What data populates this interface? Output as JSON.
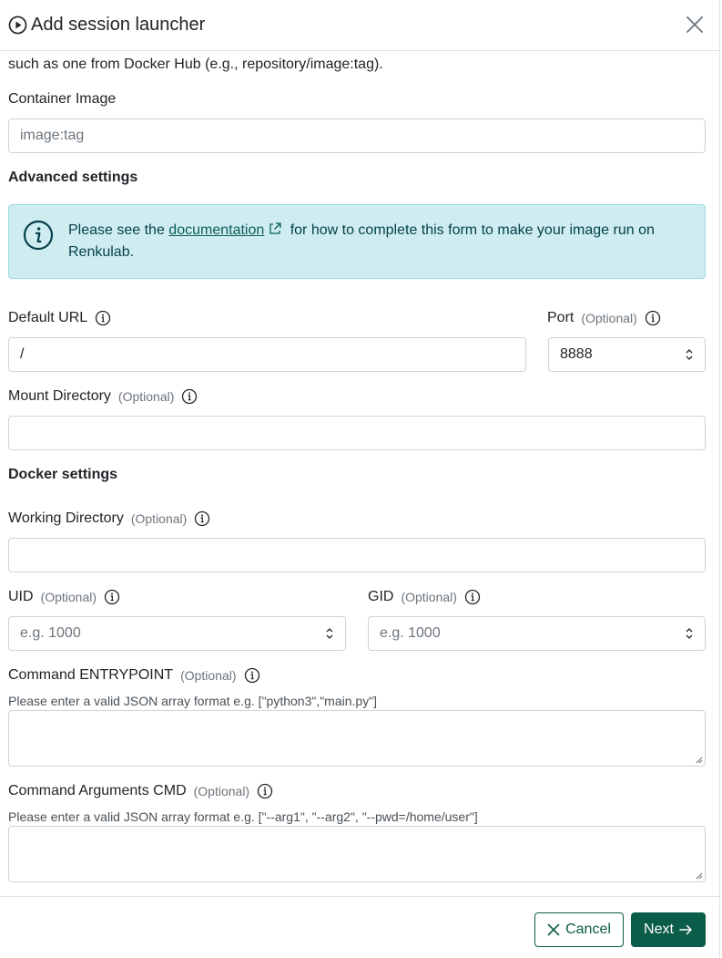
{
  "modal": {
    "title": "Add session launcher",
    "intro_text": "such as one from Docker Hub (e.g., repository/image:tag)."
  },
  "container_image": {
    "label": "Container Image",
    "placeholder": "image:tag"
  },
  "advanced": {
    "title": "Advanced settings",
    "alert_before": "Please see the ",
    "alert_link": "documentation",
    "alert_after": " for how to complete this form to make your image run on Renkulab."
  },
  "default_url": {
    "label": "Default URL",
    "value": "/"
  },
  "port": {
    "label": "Port",
    "optional": "(Optional)",
    "value": "8888"
  },
  "mount_directory": {
    "label": "Mount Directory",
    "optional": "(Optional)"
  },
  "docker": {
    "title": "Docker settings"
  },
  "working_directory": {
    "label": "Working Directory",
    "optional": "(Optional)"
  },
  "uid": {
    "label": "UID",
    "optional": "(Optional)",
    "placeholder": "e.g. 1000"
  },
  "gid": {
    "label": "GID",
    "optional": "(Optional)",
    "placeholder": "e.g. 1000"
  },
  "entrypoint": {
    "label": "Command ENTRYPOINT",
    "optional": "(Optional)",
    "help": "Please enter a valid JSON array format e.g. [\"python3\",\"main.py\"]"
  },
  "cmd": {
    "label": "Command Arguments CMD",
    "optional": "(Optional)",
    "help": "Please enter a valid JSON array format e.g. [\"--arg1\", \"--arg2\", \"--pwd=/home/user\"]"
  },
  "footer": {
    "cancel_label": "Cancel",
    "next_label": "Next"
  },
  "icons": {
    "title": "play-circle-icon",
    "close": "close-icon",
    "info": "info-circle-icon",
    "external": "external-link-icon",
    "cancel": "x-icon",
    "next": "arrow-right-icon"
  },
  "colors": {
    "primary": "#0b5c48",
    "alert_bg": "#cfedf1",
    "alert_text": "#05414a"
  }
}
